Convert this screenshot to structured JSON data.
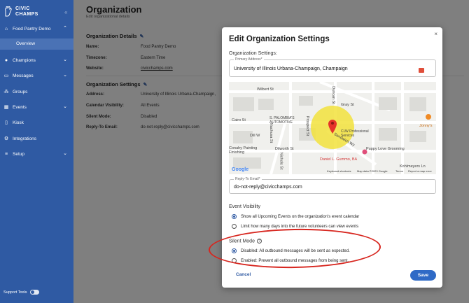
{
  "sidebar": {
    "logo_line1": "CIVIC",
    "logo_line2": "CHAMPS",
    "org_name": "Food Pantry Demo",
    "overview_label": "Overview",
    "items": [
      {
        "label": "Champions",
        "icon": "person-icon"
      },
      {
        "label": "Messages",
        "icon": "chat-icon"
      },
      {
        "label": "Groups",
        "icon": "groups-icon"
      },
      {
        "label": "Events",
        "icon": "calendar-icon"
      },
      {
        "label": "Kiosk",
        "icon": "kiosk-icon"
      },
      {
        "label": "Integrations",
        "icon": "integrations-icon"
      },
      {
        "label": "Setup",
        "icon": "setup-icon"
      }
    ],
    "support_tools": "Support Tools"
  },
  "page": {
    "title": "Organization",
    "subtitle": "Edit organizational details",
    "details_title": "Organization Details",
    "details": [
      {
        "label": "Name:",
        "value": "Food Pantry Demo"
      },
      {
        "label": "Timezone:",
        "value": "Eastern Time"
      },
      {
        "label": "Website:",
        "value": "civicchamps.com"
      }
    ],
    "settings_title": "Organization Settings",
    "settings": [
      {
        "label": "Address:",
        "value": "University of Illinois Urbana-Champaign,"
      },
      {
        "label": "Calendar Visibility:",
        "value": "All Events"
      },
      {
        "label": "Silent Mode:",
        "value": "Disabled"
      },
      {
        "label": "Reply-To Email:",
        "value": "do-not-reply@civicchamps.com"
      }
    ]
  },
  "modal": {
    "title": "Edit Organization Settings",
    "close": "×",
    "org_settings_label": "Organization Settings:",
    "address_label": "Primary Address*",
    "address_value": "University of Illinois Urbana-Champaign, Champaign",
    "map": {
      "streets": [
        "Wilbert St",
        "Gray St",
        "Cairo St",
        "Dill W",
        "Dilworth St",
        "Sandwich Wy",
        "Prospect St",
        "Nachusa St",
        "Nichols St",
        "Duncan St",
        "Kohlmeyers Ln"
      ],
      "places": [
        "S. PALOMBIA'S AUTOMOTIVE",
        "CLW Professional Services",
        "Puppy Love Grooming",
        "Daniel L. Gummo, BA",
        "Jonny's",
        "Conahy Painting Finishing"
      ],
      "footer": [
        "Keyboard shortcuts",
        "Map data ©2023 Google",
        "Terms",
        "Report a map error"
      ],
      "google": "Google"
    },
    "reply_label": "Reply-To Email*",
    "reply_value": "do-not-reply@civicchamps.com",
    "event_visibility_label": "Event Visibility",
    "event_options": [
      {
        "label": "Show all Upcoming Events on the organization's event calendar",
        "selected": true
      },
      {
        "label": "Limit how many days into the future volunteers can view events",
        "selected": false
      }
    ],
    "silent_mode_label": "Silent Mode",
    "silent_options": [
      {
        "label": "Disabled: All outbound messages will be sent as expected.",
        "selected": true
      },
      {
        "label": "Enabled: Prevent all outbound messages from being sent.",
        "selected": false
      }
    ],
    "cancel": "Cancel",
    "save": "Save"
  },
  "colors": {
    "sidebar": "#2f5aa3",
    "accent": "#2f6ac6",
    "annotation": "#d7261f"
  }
}
